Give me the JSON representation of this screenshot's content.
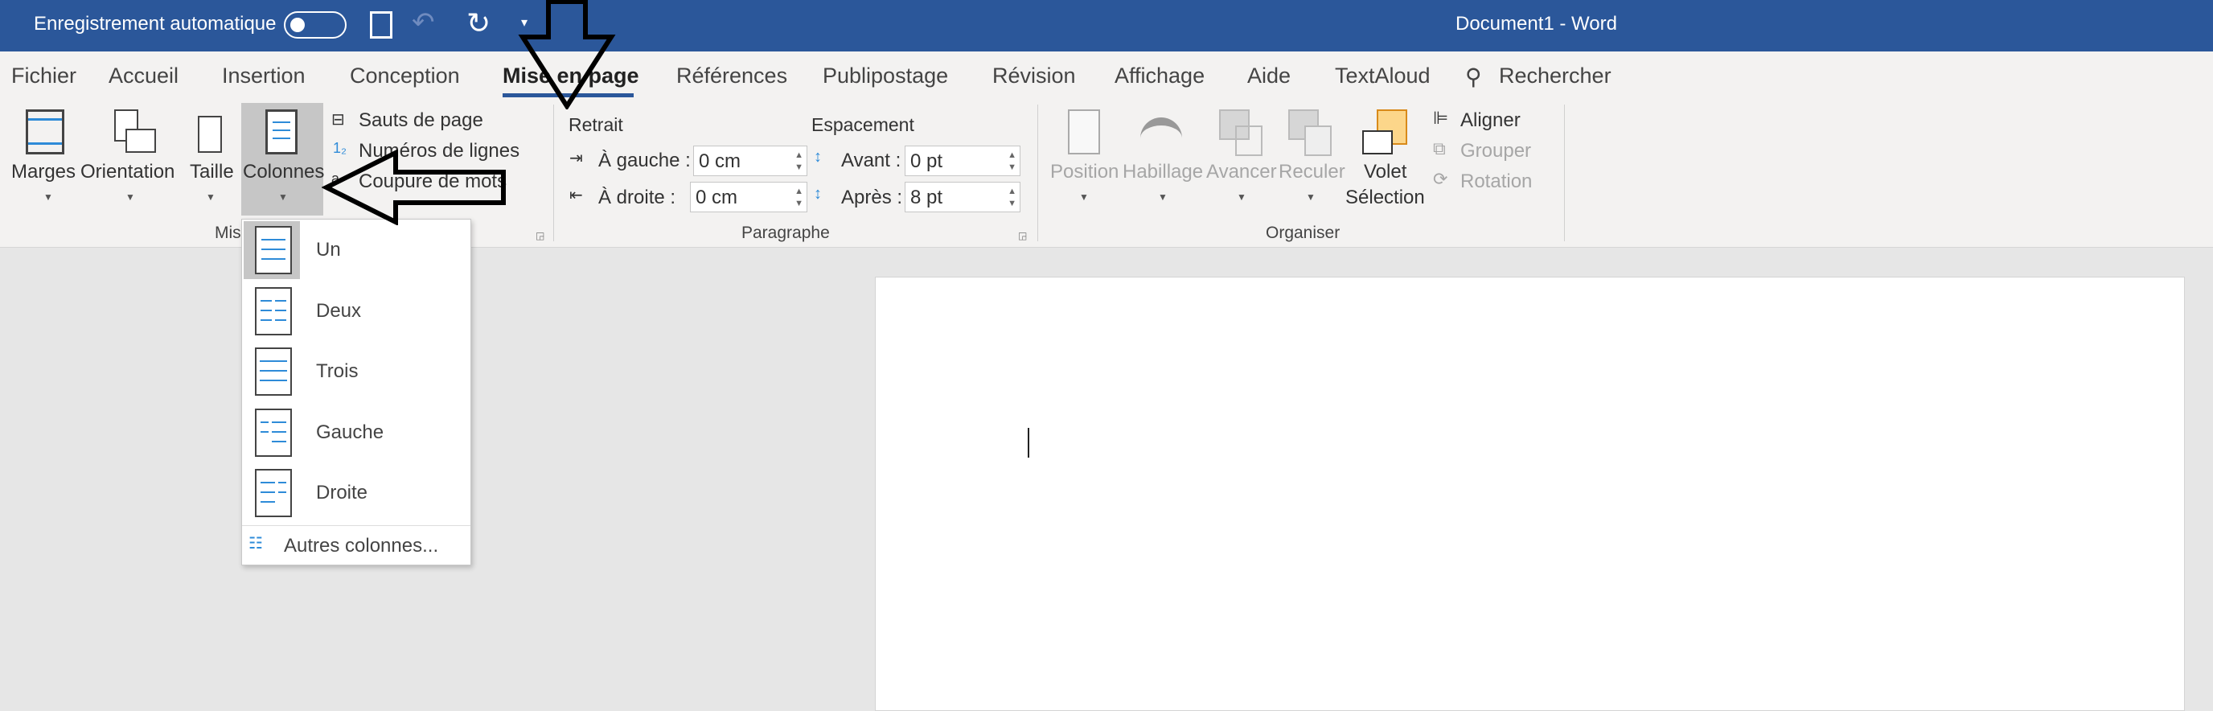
{
  "titlebar": {
    "autosave_label": "Enregistrement automatique",
    "autosave_on": false,
    "title": "Document1  -  Word"
  },
  "tabs": [
    {
      "label": "Fichier"
    },
    {
      "label": "Accueil"
    },
    {
      "label": "Insertion"
    },
    {
      "label": "Conception"
    },
    {
      "label": "Mise en page",
      "active": true
    },
    {
      "label": "Références"
    },
    {
      "label": "Publipostage"
    },
    {
      "label": "Révision"
    },
    {
      "label": "Affichage"
    },
    {
      "label": "Aide"
    },
    {
      "label": "TextAloud"
    }
  ],
  "search_label": "Rechercher",
  "ribbon": {
    "mise_en_page": {
      "marges": "Marges",
      "orientation": "Orientation",
      "taille": "Taille",
      "colonnes": "Colonnes",
      "sauts": "Sauts de page",
      "numeros": "Numéros de lignes",
      "coupure": "Coupure de mots",
      "group": "Mise en page"
    },
    "paragraphe": {
      "retrait": "Retrait",
      "espacement": "Espacement",
      "gauche_label": "À gauche :",
      "gauche_value": "0 cm",
      "droite_label": "À droite :",
      "droite_value": "0 cm",
      "avant_label": "Avant :",
      "avant_value": "0 pt",
      "apres_label": "Après :",
      "apres_value": "8 pt",
      "group": "Paragraphe"
    },
    "organiser": {
      "position": "Position",
      "habillage": "Habillage",
      "avancer": "Avancer",
      "reculer": "Reculer",
      "volet1": "Volet",
      "volet2": "Sélection",
      "aligner": "Aligner",
      "grouper": "Grouper",
      "rotation": "Rotation",
      "group": "Organiser"
    }
  },
  "columns_menu": {
    "items": [
      "Un",
      "Deux",
      "Trois",
      "Gauche",
      "Droite"
    ],
    "more": "Autres colonnes..."
  },
  "colors": {
    "accent": "#2b579a",
    "ribbon": "#f3f2f1",
    "icon_blue": "#2e8bd8"
  }
}
